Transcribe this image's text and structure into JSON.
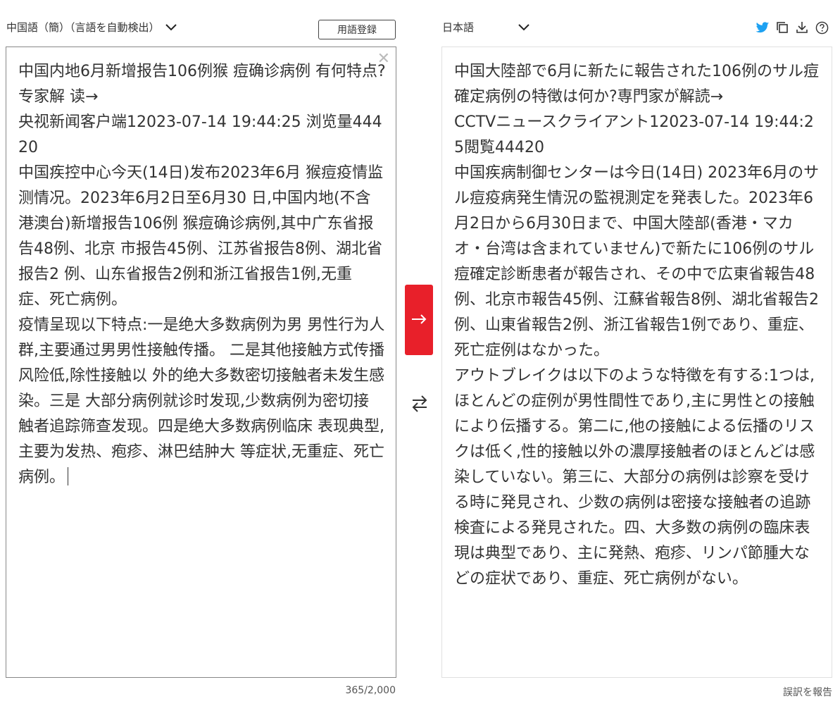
{
  "source_language": {
    "label": "中国語（簡）（言語を自動検出）"
  },
  "target_language": {
    "label": "日本語"
  },
  "term_register_button": "用語登録",
  "source_text": "中国内地6月新增报告106例猴 痘确诊病例 有何特点?专家解 读→\n央视新闻客户端12023-07-14 19:44:25 浏览量44420\n中国疾控中心今天(14日)发布2023年6月 猴痘疫情监测情况。2023年6月2日至6月30 日,中国内地(不含港澳台)新增报告106例 猴痘确诊病例,其中广东省报告48例、北京 市报告45例、江苏省报告8例、湖北省报告2 例、山东省报告2例和浙江省报告1例,无重 症、死亡病例。\n疫情呈现以下特点:一是绝大多数病例为男 男性行为人群,主要通过男男性接触传播。 二是其他接触方式传播风险低,除性接触以 外的绝大多数密切接触者未发生感染。三是 大部分病例就诊时发现,少数病例为密切接 触者追踪筛查发现。四是绝大多数病例临床 表现典型,主要为发热、疱疹、淋巴结肿大 等症状,无重症、死亡病例。",
  "translated_text": "中国大陸部で6月に新たに報告された106例のサル痘確定病例の特徴は何か?専門家が解読→\nCCTVニュースクライアント12023-07-14 19:44:25閲覧44420\n中国疾病制御センターは今日(14日) 2023年6月のサル痘疫病発生情況の監視測定を発表した。2023年6月2日から6月30日まで、中国大陸部(香港・マカオ・台湾は含まれていません)で新たに106例のサル痘確定診断患者が報告され、その中で広東省報告48例、北京市報告45例、江蘇省報告8例、湖北省報告2例、山東省報告2例、浙江省報告1例であり、重症、死亡症例はなかった。\nアウトブレイクは以下のような特徴を有する:1つは,ほとんどの症例が男性間性であり,主に男性との接触により伝播する。第二に,他の接触による伝播のリスクは低く,性的接触以外の濃厚接触者のほとんどは感染していない。第三に、大部分の病例は診察を受ける時に発見され、少数の病例は密接な接触者の追跡検査による発見された。四、大多数の病例の臨床表現は典型であり、主に発熱、疱疹、リンパ節腫大などの症状であり、重症、死亡病例がない。",
  "char_counter": "365/2,000",
  "report_error_link": "誤訳を報告",
  "icons": {
    "chevron": "chevron-down-icon",
    "twitter": "twitter-icon",
    "copy": "copy-icon",
    "download": "download-icon",
    "help": "help-icon",
    "clear": "close-icon",
    "translate": "arrow-right-icon",
    "swap": "swap-icon"
  },
  "colors": {
    "accent_red": "#e8202a",
    "twitter_blue": "#1da1f2"
  }
}
